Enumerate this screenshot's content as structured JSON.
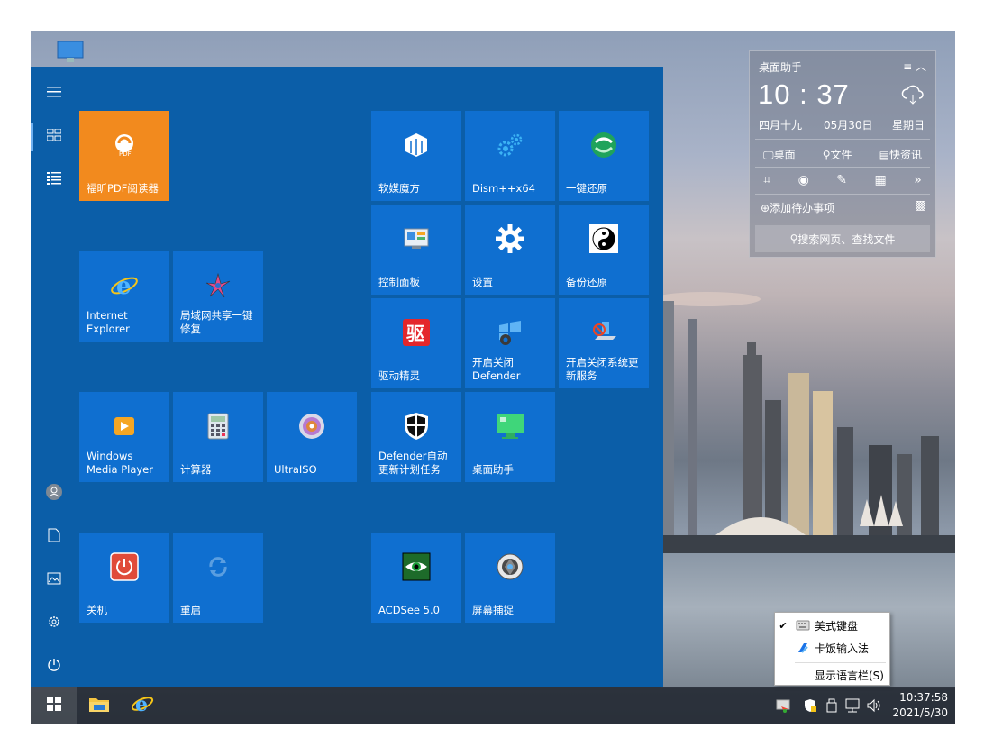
{
  "start_menu": {
    "tiles": [
      {
        "label": "福昕PDF阅读器",
        "icon": "foxit-pdf-icon"
      },
      {
        "label": "Internet Explorer",
        "icon": "ie-icon"
      },
      {
        "label": "局域网共享一键修复",
        "icon": "lan-share-icon"
      },
      {
        "label": "Windows Media Player",
        "icon": "media-player-icon"
      },
      {
        "label": "计算器",
        "icon": "calculator-icon"
      },
      {
        "label": "UltraISO",
        "icon": "ultraiso-icon"
      },
      {
        "label": "关机",
        "icon": "shutdown-icon"
      },
      {
        "label": "重启",
        "icon": "restart-icon"
      },
      {
        "label": "软媒魔方",
        "icon": "ruanmei-icon"
      },
      {
        "label": "Dism++x64",
        "icon": "dism-icon"
      },
      {
        "label": "一键还原",
        "icon": "restore-icon"
      },
      {
        "label": "控制面板",
        "icon": "control-panel-icon"
      },
      {
        "label": "设置",
        "icon": "gear-icon"
      },
      {
        "label": "备份还原",
        "icon": "backup-icon"
      },
      {
        "label": "驱动精灵",
        "icon": "driver-icon"
      },
      {
        "label": "开启关闭Defender",
        "icon": "defender-toggle-icon"
      },
      {
        "label": "开启关闭系统更新服务",
        "icon": "update-service-icon"
      },
      {
        "label": "Defender自动更新计划任务",
        "icon": "defender-shield-icon"
      },
      {
        "label": "桌面助手",
        "icon": "desktop-helper-icon"
      },
      {
        "label": "ACDSee 5.0",
        "icon": "acdsee-icon"
      },
      {
        "label": "屏幕捕捉",
        "icon": "screen-capture-icon"
      }
    ]
  },
  "widget": {
    "title": "桌面助手",
    "time": "10 : 37",
    "lunar": "四月十九",
    "date": "05月30日",
    "weekday": "星期日",
    "row1": [
      "桌面",
      "文件",
      "快资讯"
    ],
    "todo": "添加待办事项",
    "search_placeholder": "搜索网页、查找文件"
  },
  "ime_menu": {
    "items": [
      "美式键盘",
      "卡饭输入法",
      "显示语言栏(S)"
    ]
  },
  "taskbar": {
    "time": "10:37:58",
    "date": "2021/5/30"
  }
}
